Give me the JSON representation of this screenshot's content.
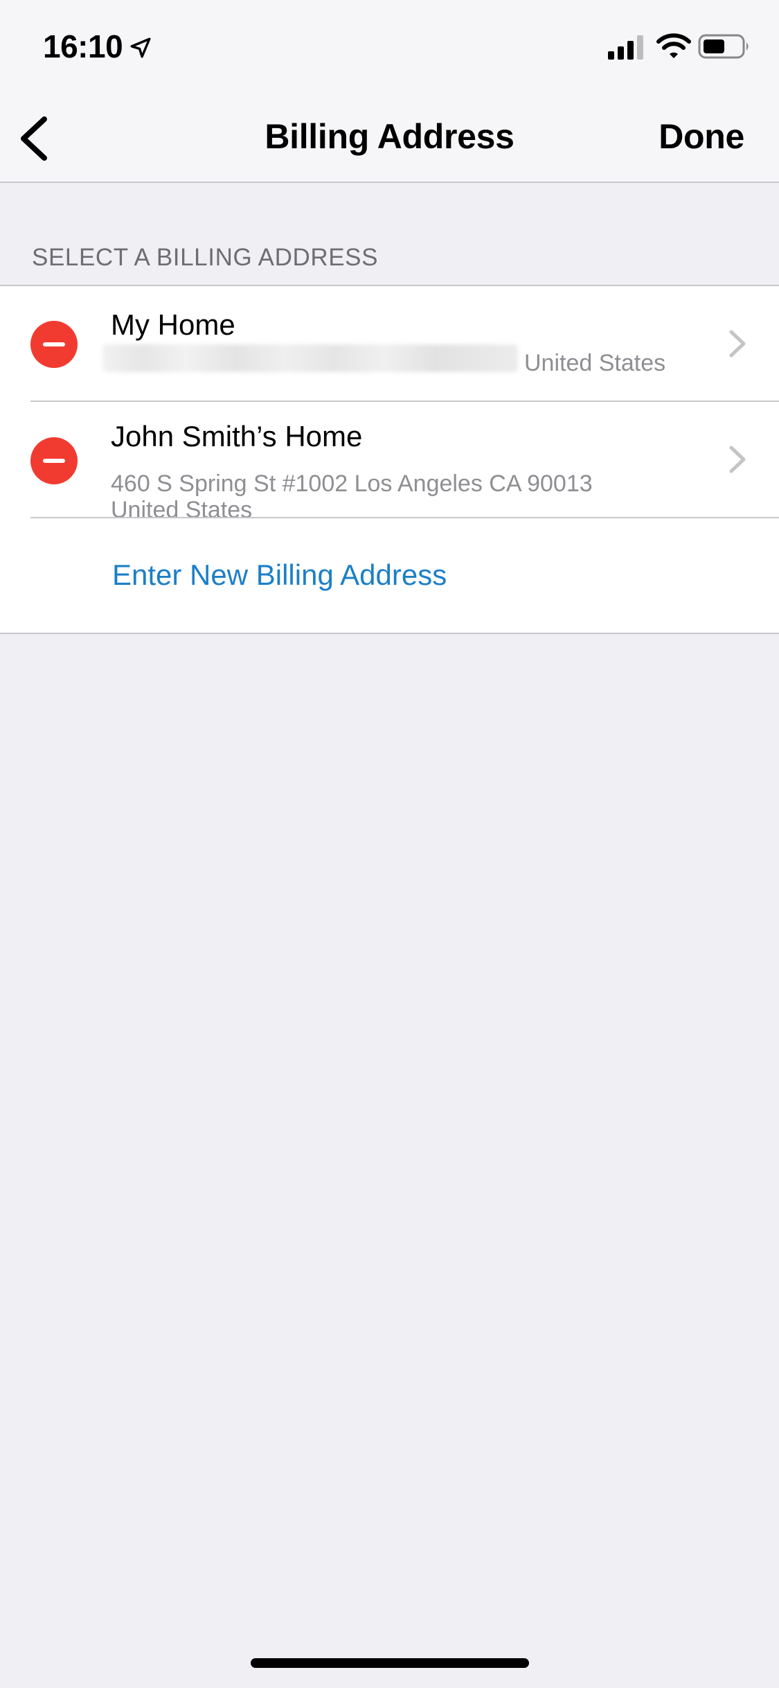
{
  "status_bar": {
    "time": "16:10"
  },
  "nav": {
    "title": "Billing Address",
    "done_label": "Done"
  },
  "section": {
    "header": "SELECT A BILLING ADDRESS"
  },
  "addresses": [
    {
      "name": "My Home",
      "street": "",
      "country": "United States"
    },
    {
      "name": "John Smith’s Home",
      "street": "460 S Spring St #1002 Los Angeles CA 90013",
      "country": "United States"
    }
  ],
  "add_new_label": "Enter New Billing Address",
  "colors": {
    "accent": "#1c7fc7",
    "delete": "#f23b30",
    "background": "#efeff4",
    "secondary_text": "#8e8e93"
  },
  "icons": {
    "back": "chevron-left-icon",
    "row_arrow": "chevron-right-icon",
    "delete": "minus-circle-icon",
    "location": "location-arrow-icon",
    "signal": "cellular-signal-icon",
    "wifi": "wifi-icon",
    "battery": "battery-icon"
  }
}
